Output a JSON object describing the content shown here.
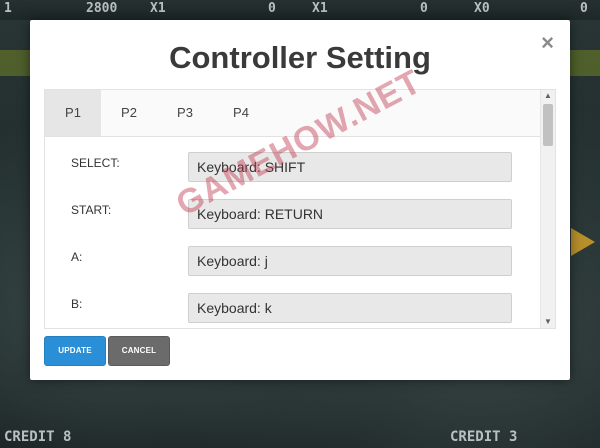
{
  "hud": {
    "top": [
      "1",
      "2800",
      "X1",
      "0",
      "X1",
      "0",
      "X0",
      "0"
    ],
    "bottom": [
      "CREDIT 8",
      "CREDIT 3"
    ]
  },
  "modal": {
    "title": "Controller Setting",
    "close_glyph": "×",
    "tabs": [
      {
        "label": "P1",
        "active": true
      },
      {
        "label": "P2",
        "active": false
      },
      {
        "label": "P3",
        "active": false
      },
      {
        "label": "P4",
        "active": false
      }
    ],
    "bindings": [
      {
        "label": "SELECT:",
        "value": "Keyboard: SHIFT"
      },
      {
        "label": "START:",
        "value": "Keyboard: RETURN"
      },
      {
        "label": "A:",
        "value": "Keyboard: j"
      },
      {
        "label": "B:",
        "value": "Keyboard: k"
      }
    ],
    "scroll_up_glyph": "▲",
    "scroll_down_glyph": "▼",
    "update_label": "UPDATE",
    "cancel_label": "CANCEL"
  },
  "watermark": "GAMEHOW.NET",
  "colors": {
    "update_button": "#2a8fd6",
    "cancel_button": "#6b6b6b",
    "active_tab": "#e6e6e6",
    "field_bg": "#e8e8e8"
  },
  "icons": {
    "close": "close-icon",
    "scroll_up": "chevron-up-icon",
    "scroll_down": "chevron-down-icon"
  }
}
